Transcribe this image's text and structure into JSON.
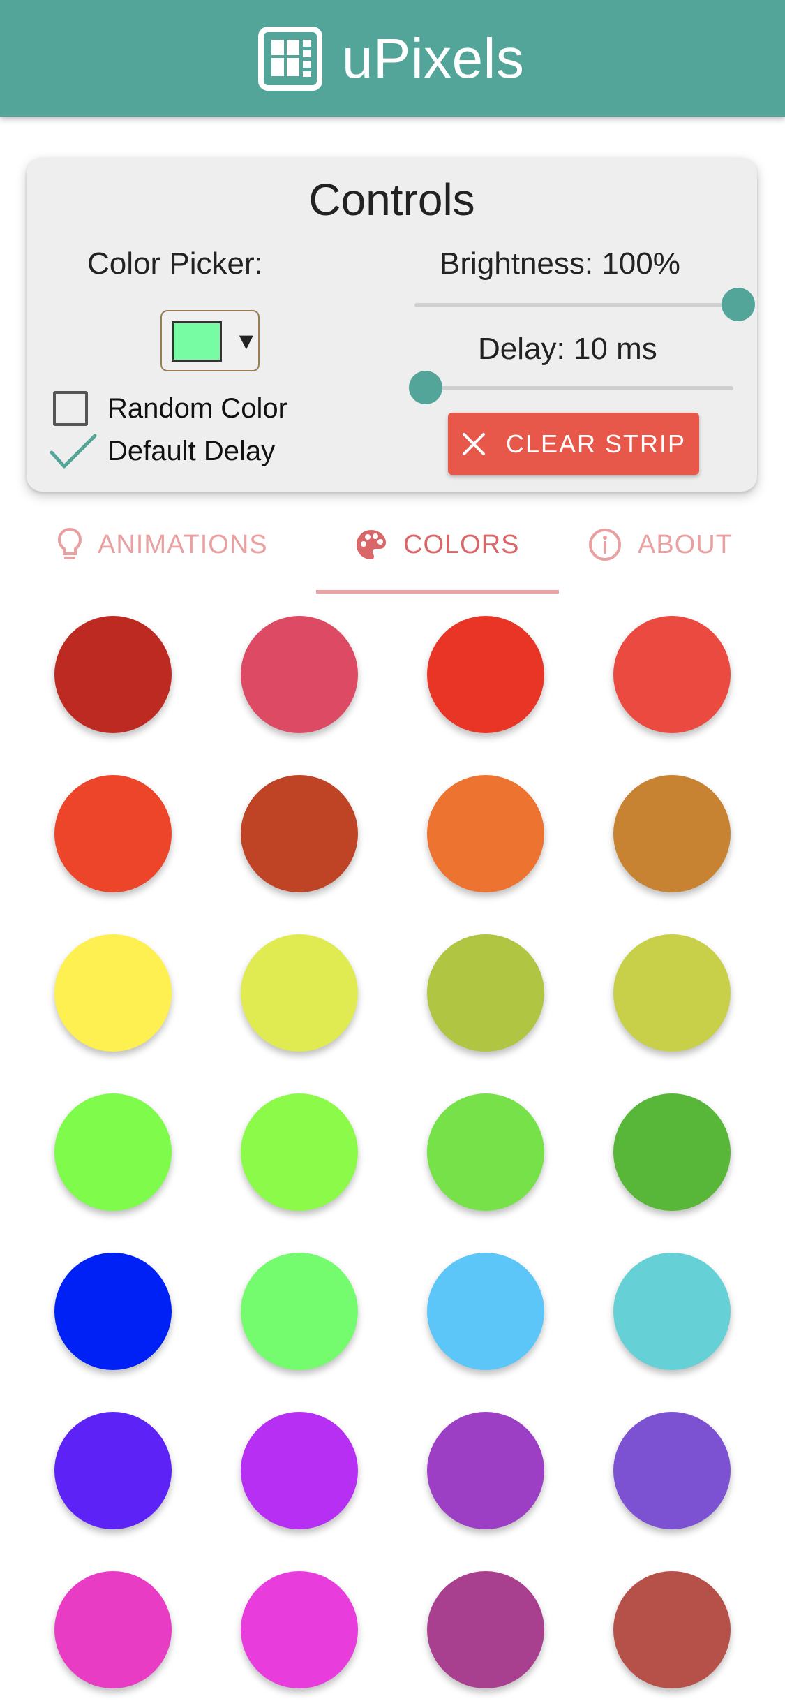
{
  "app": {
    "title": "uPixels",
    "logo_icon": "led-grid-icon",
    "header_color": "#53a59a"
  },
  "controls": {
    "title": "Controls",
    "color_picker_label": "Color Picker:",
    "picker_value": "#77fca4",
    "random_color_label": "Random Color",
    "random_color_checked": false,
    "default_delay_label": "Default Delay",
    "default_delay_checked": true,
    "brightness_label": "Brightness: 100%",
    "brightness_value": 100,
    "delay_label": "Delay: 10 ms",
    "delay_value": 0.02,
    "clear_button_label": "CLEAR STRIP",
    "accent_color": "#53a59a",
    "clear_button_color": "#e8584a"
  },
  "tabs": [
    {
      "label": "ANIMATIONS",
      "icon": "lightbulb-icon",
      "active": false
    },
    {
      "label": "COLORS",
      "icon": "palette-icon",
      "active": true
    },
    {
      "label": "ABOUT",
      "icon": "info-icon",
      "active": false
    }
  ],
  "colors": [
    "#bd2a22",
    "#dc4a64",
    "#e83525",
    "#ea4a3f",
    "#ed4529",
    "#bf4325",
    "#ed7331",
    "#c78232",
    "#fef051",
    "#dfeb51",
    "#b0c542",
    "#c8d04a",
    "#7efb4b",
    "#8cfa49",
    "#77e14a",
    "#58b738",
    "#0021f5",
    "#75fb6e",
    "#5dc6f9",
    "#65d1d6",
    "#5d22f5",
    "#b72ff3",
    "#9c3fc4",
    "#7c52d3",
    "#e93cc4",
    "#e83cdc",
    "#a8408f",
    "#b55149"
  ]
}
